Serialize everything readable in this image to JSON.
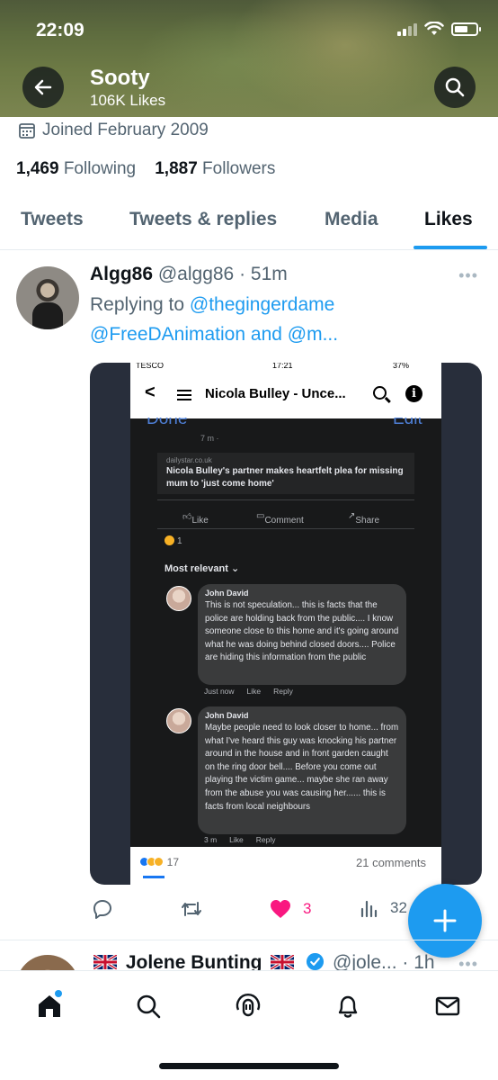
{
  "status_bar": {
    "time": "22:09"
  },
  "header": {
    "name": "Sooty",
    "likes_count": "106K Likes"
  },
  "profile": {
    "joined": "Joined February 2009",
    "following_count": "1,469",
    "following_label": "Following",
    "followers_count": "1,887",
    "followers_label": "Followers"
  },
  "tabs": [
    {
      "label": "Tweets"
    },
    {
      "label": "Tweets & replies"
    },
    {
      "label": "Media"
    },
    {
      "label": "Likes",
      "active": true
    }
  ],
  "tweet": {
    "name": "Algg86",
    "handle": "@algg86",
    "time": "51m",
    "replying_prefix": "Replying to",
    "replying_user1": "@thegingerdame",
    "replying_user2": "@FreeDAnimation",
    "replying_and": "and",
    "replying_user3": "@m...",
    "reply_count": "",
    "retweet_count": "",
    "like_count": "3",
    "view_count": "32",
    "like_color": "#f91880",
    "media": {
      "status_left": "TESCO",
      "status_time": "17:21",
      "status_battery": "37%",
      "nav_title": "Nicola Bulley - Unce...",
      "done": "Done",
      "edit": "Edit",
      "post_time": "7 m ·",
      "source": "dailystar.co.uk",
      "headline": "Nicola Bulley's partner makes heartfelt plea for missing mum to 'just come home'",
      "like": "Like",
      "comment": "Comment",
      "share": "Share",
      "reaction_count": "1",
      "most_relevant": "Most relevant ⌄",
      "comments": [
        {
          "author": "John David",
          "text": "This is not speculation... this is facts that the police are holding back from the public.... I know someone close to this home and it's going around what he was doing behind closed doors.... Police are hiding this information from the public",
          "time": "Just now",
          "like": "Like",
          "reply": "Reply"
        },
        {
          "author": "John David",
          "text": "Maybe people need to look closer to home... from what I've heard this guy was knocking his partner around in the house and in front garden caught on the ring door bell.... Before you come out playing the victim game... maybe she ran away from the abuse you was causing her...... this is facts from local neighbours",
          "time": "3 m",
          "like": "Like",
          "reply": "Reply"
        }
      ],
      "bottom_reactions": "17",
      "bottom_comments": "21 comments"
    }
  },
  "next_tweet": {
    "name": "Jolene Bunting",
    "handle": "@jole...",
    "time": "1h"
  },
  "nav": {
    "home": "home-icon",
    "search": "search-icon",
    "spaces": "spaces-icon",
    "notifications": "bell-icon",
    "messages": "mail-icon"
  },
  "colors": {
    "accent": "#1d9bf0",
    "text": "#0f1419",
    "secondary": "#536471"
  }
}
